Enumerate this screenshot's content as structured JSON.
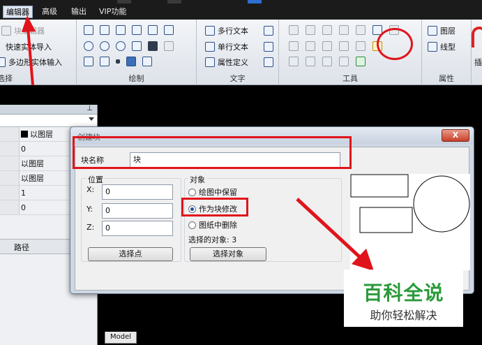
{
  "menu": {
    "items": [
      "编辑器",
      "高级",
      "输出",
      "VIP功能"
    ],
    "active": "编辑器"
  },
  "ribbon": {
    "select_group": {
      "items": [
        "块编辑器",
        "快速实体导入",
        "多边形实体输入"
      ],
      "label": "选择"
    },
    "draw_group": {
      "label": "绘制"
    },
    "text_group": {
      "items": [
        "多行文本",
        "单行文本",
        "属性定义"
      ],
      "label": "文字"
    },
    "tools_group": {
      "label": "工具"
    },
    "props_group": {
      "items": [
        "图层",
        "线型"
      ],
      "label": "属性"
    },
    "next_label": "插"
  },
  "side_panel": {
    "rows": [
      "以图层",
      "0",
      "以图层",
      "以图层",
      "1",
      "0"
    ],
    "path_label": "路径"
  },
  "model_tab": "Model",
  "dialog": {
    "title": "创建块",
    "close": "X",
    "name_label": "块名称",
    "name_value": "块",
    "position": {
      "legend": "位置",
      "x_label": "X:",
      "x_value": "0",
      "y_label": "Y:",
      "y_value": "0",
      "z_label": "Z:",
      "z_value": "0",
      "pick_button": "选择点"
    },
    "objects": {
      "legend": "对象",
      "radios": [
        "绘图中保留",
        "作为块修改",
        "图纸中删除"
      ],
      "selected_index": 1,
      "count_text": "选择的对象: 3",
      "select_button": "选择对象"
    }
  },
  "watermark": {
    "title": "百科全说",
    "subtitle": "助你轻松解决"
  },
  "colors": {
    "annotation": "#e0141b",
    "watermark_green": "#2a9a3a"
  }
}
